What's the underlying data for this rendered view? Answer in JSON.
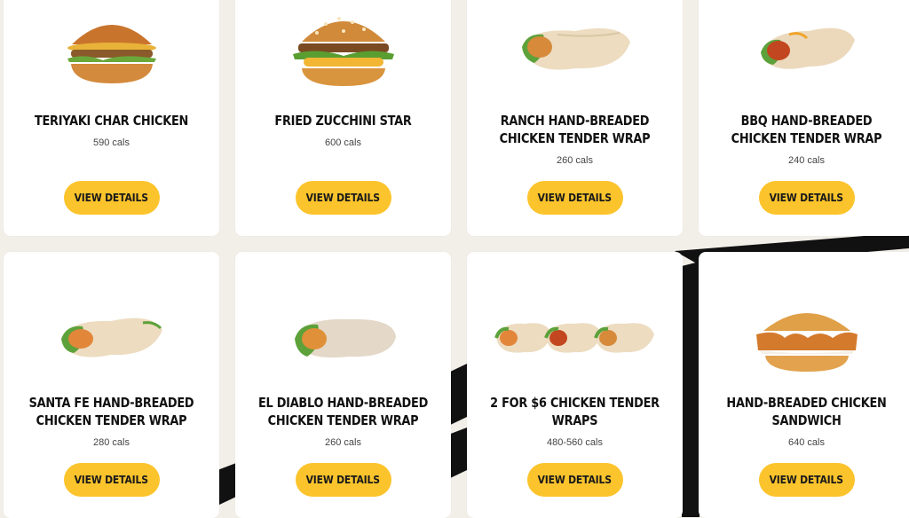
{
  "colors": {
    "background": "#f2eee8",
    "card": "#ffffff",
    "button": "#fcc42c",
    "text": "#111111"
  },
  "button_label": "VIEW DETAILS",
  "items": [
    {
      "name": "TERIYAKI CHAR CHICKEN",
      "cals": "590 cals",
      "image": "burger-icon"
    },
    {
      "name": "FRIED ZUCCHINI STAR",
      "cals": "600 cals",
      "image": "burger-icon"
    },
    {
      "name": "RANCH HAND-BREADED CHICKEN TENDER WRAP",
      "cals": "260 cals",
      "image": "wrap-icon"
    },
    {
      "name": "BBQ HAND-BREADED CHICKEN TENDER WRAP",
      "cals": "240 cals",
      "image": "wrap-icon"
    },
    {
      "name": "SANTA FE HAND-BREADED CHICKEN TENDER WRAP",
      "cals": "280 cals",
      "image": "wrap-icon"
    },
    {
      "name": "EL DIABLO HAND-BREADED CHICKEN TENDER WRAP",
      "cals": "260 cals",
      "image": "wrap-icon"
    },
    {
      "name": "2 FOR $6 CHICKEN TENDER WRAPS",
      "cals": "480-560 cals",
      "image": "wraps-icon"
    },
    {
      "name": "HAND-BREADED CHICKEN SANDWICH",
      "cals": "640 cals",
      "image": "burger-icon"
    }
  ]
}
